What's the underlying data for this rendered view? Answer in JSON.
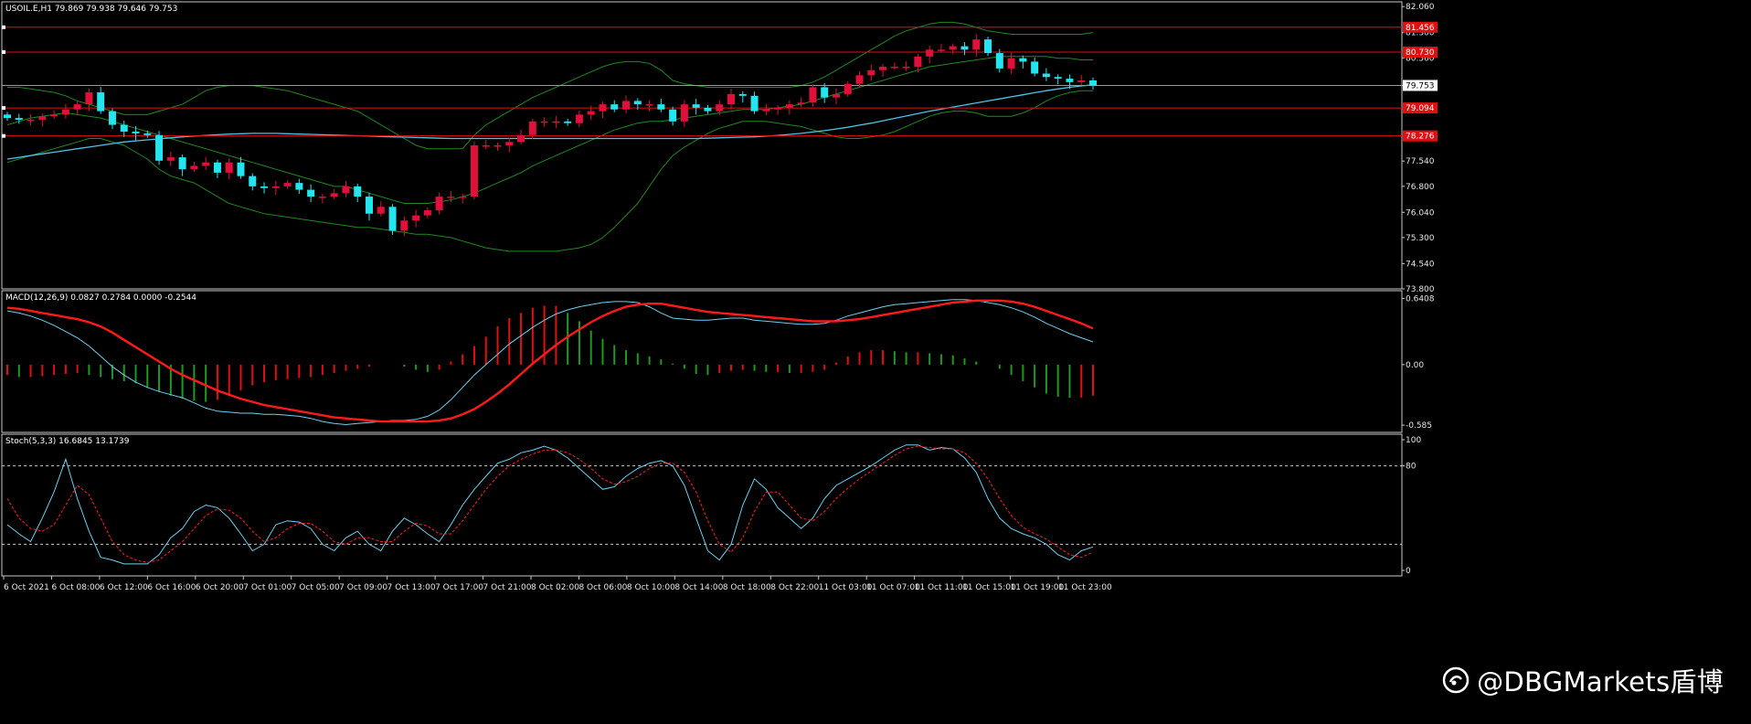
{
  "chart_data": [
    {
      "type": "candlestick",
      "title": "USOIL.E,H1  79.869 79.938 79.646 79.753",
      "ylim": [
        73.8,
        82.2
      ],
      "y_ticks": [
        "82.060",
        "81.300",
        "80.560",
        "79.753",
        "77.540",
        "76.800",
        "76.040",
        "75.300",
        "74.540",
        "73.800"
      ],
      "y_tick_values": [
        82.06,
        81.3,
        80.56,
        79.753,
        77.54,
        76.8,
        76.04,
        75.3,
        74.54,
        73.8
      ],
      "horizontal_lines": [
        {
          "label": "81.456",
          "value": 81.456
        },
        {
          "label": "80.730",
          "value": 80.73
        },
        {
          "label": "79.094",
          "value": 79.094
        },
        {
          "label": "78.276",
          "value": 78.276
        }
      ],
      "current_price": {
        "label": "79.753",
        "value": 79.753
      },
      "x_tick_labels": [
        "6 Oct 2021",
        "6 Oct 08:00",
        "6 Oct 12:00",
        "6 Oct 16:00",
        "6 Oct 20:00",
        "7 Oct 01:00",
        "7 Oct 05:00",
        "7 Oct 09:00",
        "7 Oct 13:00",
        "7 Oct 17:00",
        "7 Oct 21:00",
        "8 Oct 02:00",
        "8 Oct 06:00",
        "8 Oct 10:00",
        "8 Oct 14:00",
        "8 Oct 18:00",
        "8 Oct 22:00",
        "11 Oct 03:00",
        "11 Oct 07:00",
        "11 Oct 11:00",
        "11 Oct 15:00",
        "11 Oct 19:00",
        "11 Oct 23:00"
      ],
      "candles_close": [
        78.8,
        78.75,
        78.75,
        78.85,
        78.9,
        79.05,
        79.2,
        79.55,
        79.0,
        78.6,
        78.4,
        78.35,
        78.3,
        77.55,
        77.65,
        77.3,
        77.4,
        77.5,
        77.2,
        77.5,
        77.1,
        76.8,
        76.75,
        76.8,
        76.9,
        76.7,
        76.5,
        76.5,
        76.6,
        76.8,
        76.5,
        76.0,
        76.2,
        75.5,
        75.8,
        75.95,
        76.1,
        76.5,
        76.5,
        76.5,
        78.0,
        78.0,
        78.0,
        78.1,
        78.3,
        78.7,
        78.7,
        78.7,
        78.65,
        78.9,
        79.0,
        79.2,
        79.05,
        79.3,
        79.2,
        79.2,
        79.05,
        78.7,
        79.2,
        79.1,
        79.0,
        79.2,
        79.5,
        79.45,
        79.0,
        79.05,
        79.1,
        79.2,
        79.25,
        79.7,
        79.4,
        79.5,
        79.8,
        80.05,
        80.2,
        80.3,
        80.3,
        80.3,
        80.6,
        80.8,
        80.8,
        80.9,
        80.8,
        81.1,
        80.7,
        80.25,
        80.55,
        80.45,
        80.1,
        80.0,
        79.95,
        79.85,
        79.9,
        79.75
      ],
      "bollinger_upper": [
        79.7,
        79.7,
        79.65,
        79.6,
        79.55,
        79.45,
        79.3,
        79.2,
        79.1,
        79.0,
        78.9,
        78.9,
        78.9,
        79.0,
        79.1,
        79.2,
        79.4,
        79.6,
        79.7,
        79.75,
        79.75,
        79.75,
        79.7,
        79.65,
        79.6,
        79.5,
        79.4,
        79.3,
        79.2,
        79.1,
        79.0,
        78.8,
        78.6,
        78.4,
        78.2,
        78.0,
        77.9,
        77.9,
        77.9,
        77.9,
        78.3,
        78.6,
        78.8,
        79.0,
        79.2,
        79.4,
        79.55,
        79.7,
        79.85,
        80.0,
        80.15,
        80.3,
        80.4,
        80.45,
        80.45,
        80.4,
        80.2,
        79.9,
        79.8,
        79.75,
        79.7,
        79.7,
        79.7,
        79.7,
        79.7,
        79.7,
        79.7,
        79.7,
        79.75,
        79.85,
        80.0,
        80.2,
        80.4,
        80.6,
        80.8,
        81.0,
        81.2,
        81.35,
        81.45,
        81.55,
        81.6,
        81.6,
        81.55,
        81.45,
        81.35,
        81.3,
        81.25,
        81.25,
        81.25,
        81.25,
        81.25,
        81.25,
        81.25,
        81.3
      ],
      "bollinger_middle": [
        78.6,
        78.7,
        78.8,
        78.85,
        78.9,
        78.95,
        78.9,
        78.85,
        78.8,
        78.7,
        78.6,
        78.5,
        78.4,
        78.3,
        78.2,
        78.1,
        78.0,
        77.9,
        77.8,
        77.7,
        77.6,
        77.5,
        77.4,
        77.3,
        77.2,
        77.1,
        77.0,
        76.9,
        76.8,
        76.8,
        76.7,
        76.6,
        76.5,
        76.4,
        76.3,
        76.3,
        76.3,
        76.35,
        76.4,
        76.5,
        76.6,
        76.75,
        76.9,
        77.05,
        77.2,
        77.4,
        77.55,
        77.7,
        77.85,
        78.0,
        78.15,
        78.3,
        78.45,
        78.55,
        78.65,
        78.7,
        78.7,
        78.75,
        78.8,
        78.85,
        78.9,
        78.95,
        79.0,
        79.05,
        79.05,
        79.05,
        79.1,
        79.15,
        79.2,
        79.3,
        79.4,
        79.5,
        79.6,
        79.7,
        79.8,
        79.9,
        80.0,
        80.1,
        80.2,
        80.3,
        80.35,
        80.4,
        80.45,
        80.5,
        80.55,
        80.6,
        80.6,
        80.6,
        80.6,
        80.6,
        80.55,
        80.55,
        80.5,
        80.5
      ],
      "bollinger_lower": [
        77.5,
        77.6,
        77.7,
        77.8,
        77.9,
        78.0,
        78.1,
        78.2,
        78.2,
        78.1,
        78.0,
        77.8,
        77.6,
        77.3,
        77.1,
        77.0,
        76.9,
        76.7,
        76.5,
        76.3,
        76.2,
        76.1,
        76.0,
        75.95,
        75.9,
        75.85,
        75.8,
        75.75,
        75.7,
        75.65,
        75.6,
        75.6,
        75.55,
        75.5,
        75.45,
        75.4,
        75.4,
        75.35,
        75.3,
        75.2,
        75.1,
        75.0,
        74.95,
        74.9,
        74.9,
        74.9,
        74.9,
        74.9,
        74.95,
        75.0,
        75.1,
        75.3,
        75.6,
        75.95,
        76.3,
        76.8,
        77.3,
        77.7,
        77.95,
        78.15,
        78.35,
        78.5,
        78.6,
        78.7,
        78.7,
        78.7,
        78.65,
        78.6,
        78.55,
        78.45,
        78.35,
        78.25,
        78.2,
        78.2,
        78.25,
        78.3,
        78.4,
        78.55,
        78.7,
        78.85,
        78.95,
        79.0,
        79.0,
        78.95,
        78.85,
        78.85,
        78.85,
        78.95,
        79.1,
        79.3,
        79.45,
        79.55,
        79.6,
        79.6
      ],
      "moving_average": [
        77.6,
        77.65,
        77.7,
        77.75,
        77.8,
        77.85,
        77.9,
        77.95,
        78.0,
        78.05,
        78.1,
        78.13,
        78.16,
        78.19,
        78.22,
        78.25,
        78.27,
        78.29,
        78.31,
        78.33,
        78.34,
        78.35,
        78.35,
        78.35,
        78.34,
        78.33,
        78.32,
        78.31,
        78.3,
        78.29,
        78.28,
        78.27,
        78.26,
        78.25,
        78.24,
        78.23,
        78.22,
        78.21,
        78.2,
        78.2,
        78.2,
        78.2,
        78.2,
        78.2,
        78.2,
        78.2,
        78.2,
        78.2,
        78.2,
        78.2,
        78.2,
        78.2,
        78.2,
        78.2,
        78.2,
        78.2,
        78.2,
        78.2,
        78.2,
        78.2,
        78.21,
        78.22,
        78.23,
        78.24,
        78.25,
        78.27,
        78.29,
        78.32,
        78.35,
        78.39,
        78.43,
        78.48,
        78.53,
        78.59,
        78.65,
        78.72,
        78.79,
        78.86,
        78.93,
        79.0,
        79.06,
        79.12,
        79.18,
        79.24,
        79.3,
        79.36,
        79.42,
        79.48,
        79.54,
        79.6,
        79.65,
        79.7,
        79.74,
        79.77
      ]
    },
    {
      "type": "macd",
      "title": "MACD(12,26,9) 0.0827 0.2784 0.0000 -0.2544",
      "ylim": [
        -0.62,
        0.68
      ],
      "y_ticks": [
        "0.6408",
        "0.00",
        "-0.585"
      ],
      "y_tick_values": [
        0.6408,
        0.0,
        -0.585
      ],
      "macd_line": [
        0.52,
        0.5,
        0.47,
        0.43,
        0.38,
        0.32,
        0.26,
        0.18,
        0.08,
        -0.02,
        -0.1,
        -0.17,
        -0.22,
        -0.26,
        -0.29,
        -0.32,
        -0.37,
        -0.42,
        -0.45,
        -0.46,
        -0.47,
        -0.47,
        -0.48,
        -0.48,
        -0.49,
        -0.5,
        -0.52,
        -0.55,
        -0.57,
        -0.58,
        -0.57,
        -0.56,
        -0.55,
        -0.54,
        -0.54,
        -0.53,
        -0.5,
        -0.44,
        -0.34,
        -0.22,
        -0.1,
        0.0,
        0.1,
        0.2,
        0.28,
        0.36,
        0.43,
        0.49,
        0.53,
        0.56,
        0.58,
        0.6,
        0.61,
        0.61,
        0.6,
        0.56,
        0.5,
        0.45,
        0.44,
        0.43,
        0.43,
        0.44,
        0.45,
        0.45,
        0.43,
        0.42,
        0.41,
        0.4,
        0.39,
        0.39,
        0.4,
        0.43,
        0.47,
        0.5,
        0.53,
        0.56,
        0.58,
        0.59,
        0.6,
        0.61,
        0.62,
        0.63,
        0.63,
        0.62,
        0.6,
        0.58,
        0.55,
        0.51,
        0.46,
        0.4,
        0.35,
        0.3,
        0.26,
        0.22
      ],
      "signal_line": [
        0.55,
        0.54,
        0.52,
        0.5,
        0.48,
        0.46,
        0.44,
        0.41,
        0.37,
        0.31,
        0.24,
        0.17,
        0.1,
        0.03,
        -0.04,
        -0.1,
        -0.15,
        -0.2,
        -0.25,
        -0.29,
        -0.33,
        -0.36,
        -0.39,
        -0.41,
        -0.43,
        -0.45,
        -0.47,
        -0.49,
        -0.51,
        -0.52,
        -0.53,
        -0.54,
        -0.55,
        -0.55,
        -0.55,
        -0.55,
        -0.55,
        -0.54,
        -0.52,
        -0.48,
        -0.43,
        -0.36,
        -0.28,
        -0.19,
        -0.09,
        0.01,
        0.1,
        0.19,
        0.27,
        0.34,
        0.41,
        0.47,
        0.52,
        0.56,
        0.58,
        0.59,
        0.59,
        0.57,
        0.55,
        0.53,
        0.51,
        0.5,
        0.49,
        0.48,
        0.47,
        0.46,
        0.45,
        0.44,
        0.43,
        0.42,
        0.42,
        0.42,
        0.43,
        0.44,
        0.46,
        0.48,
        0.5,
        0.52,
        0.54,
        0.56,
        0.58,
        0.6,
        0.61,
        0.62,
        0.62,
        0.62,
        0.61,
        0.59,
        0.56,
        0.52,
        0.48,
        0.44,
        0.4,
        0.35
      ],
      "histogram": [
        -0.1,
        -0.12,
        -0.12,
        -0.11,
        -0.1,
        -0.09,
        -0.08,
        -0.1,
        -0.12,
        -0.14,
        -0.16,
        -0.18,
        -0.22,
        -0.26,
        -0.3,
        -0.33,
        -0.35,
        -0.36,
        -0.34,
        -0.3,
        -0.25,
        -0.2,
        -0.17,
        -0.15,
        -0.14,
        -0.13,
        -0.12,
        -0.1,
        -0.08,
        -0.06,
        -0.04,
        -0.02,
        0.0,
        0.0,
        -0.02,
        -0.05,
        -0.07,
        -0.05,
        0.03,
        0.1,
        0.18,
        0.27,
        0.37,
        0.45,
        0.5,
        0.55,
        0.57,
        0.57,
        0.5,
        0.42,
        0.33,
        0.25,
        0.19,
        0.14,
        0.11,
        0.08,
        0.05,
        0.01,
        -0.04,
        -0.09,
        -0.1,
        -0.08,
        -0.06,
        -0.05,
        -0.06,
        -0.07,
        -0.07,
        -0.08,
        -0.08,
        -0.07,
        -0.05,
        0.02,
        0.08,
        0.12,
        0.14,
        0.14,
        0.13,
        0.12,
        0.12,
        0.11,
        0.1,
        0.09,
        0.06,
        0.03,
        0.0,
        -0.04,
        -0.1,
        -0.16,
        -0.22,
        -0.28,
        -0.31,
        -0.32,
        -0.32,
        -0.3
      ]
    },
    {
      "type": "stochastic",
      "title": "Stoch(5,3,3) 16.6845 13.1739",
      "ylim": [
        0,
        100
      ],
      "y_ticks": [
        "100",
        "80",
        "0"
      ],
      "y_tick_values": [
        100,
        80,
        0
      ],
      "levels": [
        80,
        20
      ],
      "k_line": [
        35,
        28,
        22,
        40,
        60,
        85,
        55,
        30,
        10,
        8,
        5,
        5,
        5,
        12,
        25,
        32,
        45,
        50,
        48,
        40,
        28,
        15,
        20,
        35,
        38,
        37,
        32,
        20,
        15,
        25,
        30,
        20,
        15,
        30,
        40,
        35,
        28,
        22,
        35,
        50,
        62,
        72,
        82,
        85,
        90,
        92,
        95,
        92,
        86,
        78,
        70,
        62,
        64,
        72,
        78,
        82,
        84,
        80,
        65,
        40,
        15,
        8,
        20,
        50,
        70,
        62,
        48,
        40,
        32,
        40,
        55,
        65,
        70,
        75,
        80,
        86,
        92,
        96,
        96,
        92,
        94,
        93,
        86,
        75,
        55,
        40,
        32,
        28,
        25,
        20,
        12,
        8,
        15,
        18
      ],
      "d_line": [
        55,
        40,
        32,
        30,
        35,
        50,
        65,
        58,
        40,
        22,
        12,
        8,
        6,
        8,
        15,
        22,
        32,
        42,
        47,
        46,
        40,
        30,
        22,
        25,
        32,
        36,
        36,
        30,
        22,
        20,
        25,
        25,
        22,
        22,
        30,
        36,
        34,
        28,
        28,
        38,
        50,
        62,
        72,
        80,
        85,
        89,
        92,
        92,
        90,
        85,
        78,
        70,
        66,
        68,
        72,
        78,
        82,
        82,
        75,
        60,
        38,
        20,
        14,
        25,
        45,
        60,
        60,
        50,
        40,
        38,
        45,
        55,
        63,
        70,
        76,
        82,
        88,
        93,
        95,
        94,
        93,
        93,
        90,
        82,
        70,
        55,
        42,
        33,
        28,
        24,
        18,
        12,
        10,
        14
      ]
    }
  ],
  "watermark": {
    "text": "@DBGMarkets盾博",
    "icon": "weibo-logo-icon"
  }
}
